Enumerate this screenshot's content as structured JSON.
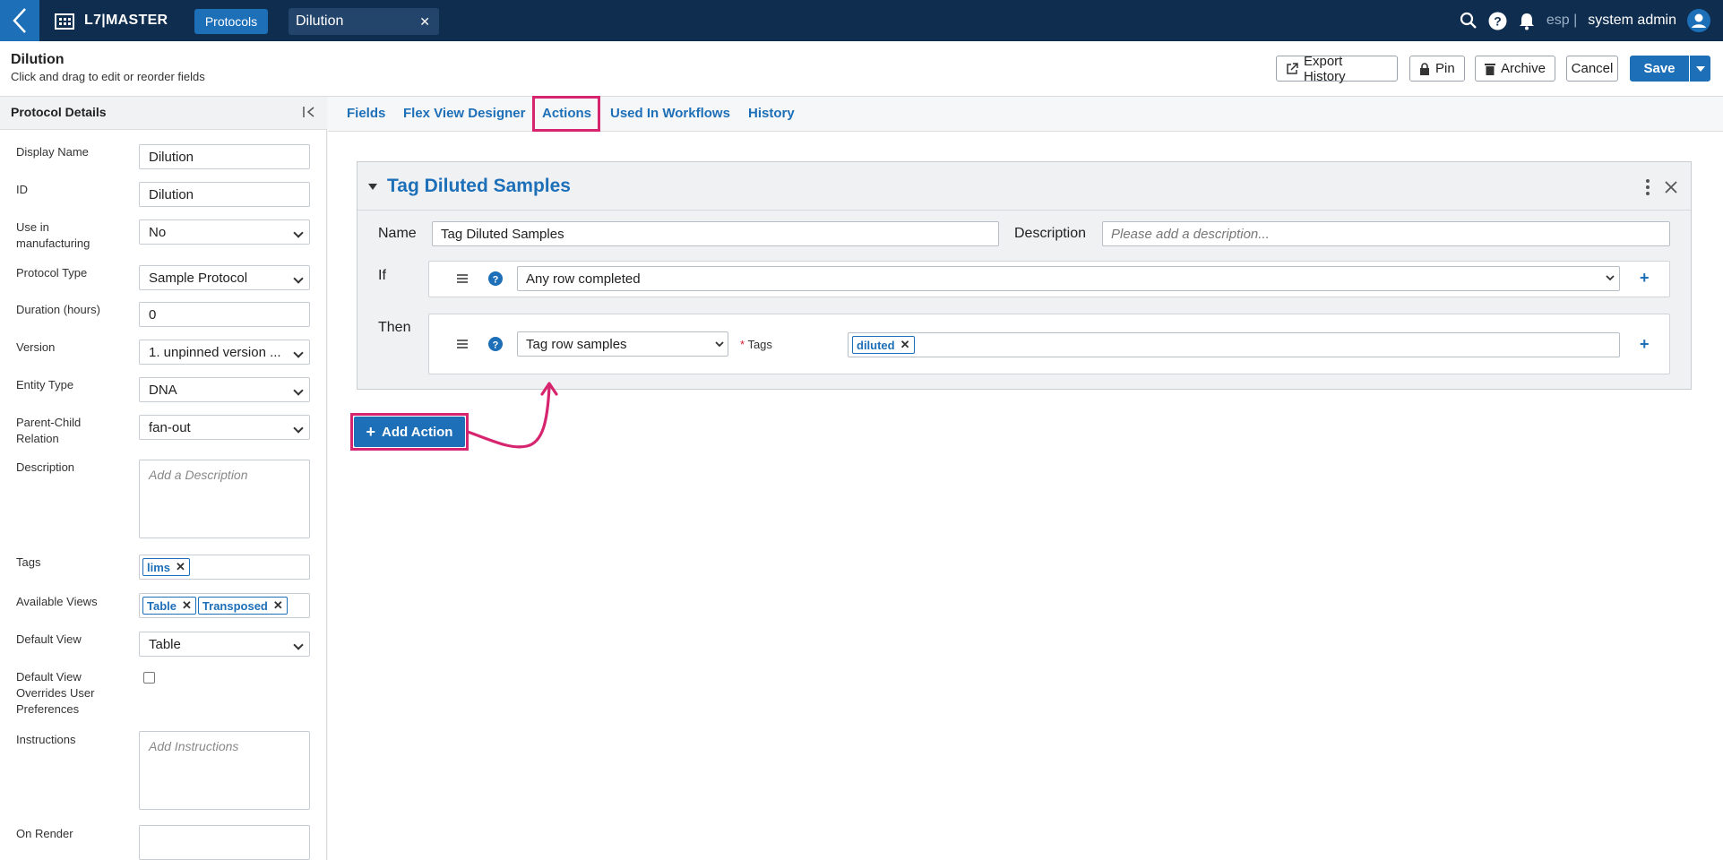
{
  "topbar": {
    "app_name": "L7|MASTER",
    "nav_button": "Protocols",
    "doc_tab": "Dilution",
    "lang": "esp |",
    "user": "system admin"
  },
  "header": {
    "title": "Dilution",
    "subtitle": "Click and drag to edit or reorder fields",
    "buttons": {
      "export": "Export History",
      "pin": "Pin",
      "archive": "Archive",
      "cancel": "Cancel",
      "save": "Save"
    }
  },
  "left": {
    "title": "Protocol Details",
    "fields": {
      "display_name": {
        "label": "Display Name",
        "value": "Dilution"
      },
      "id": {
        "label": "ID",
        "value": "Dilution"
      },
      "use_mfg": {
        "label": "Use in manufacturing",
        "value": "No"
      },
      "protocol_type": {
        "label": "Protocol Type",
        "value": "Sample Protocol"
      },
      "duration": {
        "label": "Duration (hours)",
        "value": "0"
      },
      "version": {
        "label": "Version",
        "value": "1. unpinned version ..."
      },
      "entity_type": {
        "label": "Entity Type",
        "value": "DNA"
      },
      "parent_child": {
        "label": "Parent-Child Relation",
        "value": "fan-out"
      },
      "description": {
        "label": "Description",
        "placeholder": "Add a Description"
      },
      "tags": {
        "label": "Tags",
        "chips": [
          "lims"
        ]
      },
      "available_views": {
        "label": "Available Views",
        "chips": [
          "Table",
          "Transposed"
        ]
      },
      "default_view": {
        "label": "Default View",
        "value": "Table"
      },
      "default_override": {
        "label": "Default View Overrides User Preferences"
      },
      "instructions": {
        "label": "Instructions",
        "placeholder": "Add Instructions"
      },
      "on_render": {
        "label": "On Render"
      }
    }
  },
  "tabs": [
    "Fields",
    "Flex View Designer",
    "Actions",
    "Used In Workflows",
    "History"
  ],
  "action": {
    "title": "Tag Diluted Samples",
    "name_label": "Name",
    "name_value": "Tag Diluted Samples",
    "desc_label": "Description",
    "desc_placeholder": "Please add a description...",
    "if_label": "If",
    "if_value": "Any row completed",
    "then_label": "Then",
    "then_value": "Tag row samples",
    "tags_label": "Tags",
    "tags_required": "*",
    "tag_chip": "diluted",
    "plus": "+",
    "add_button": "Add Action"
  }
}
